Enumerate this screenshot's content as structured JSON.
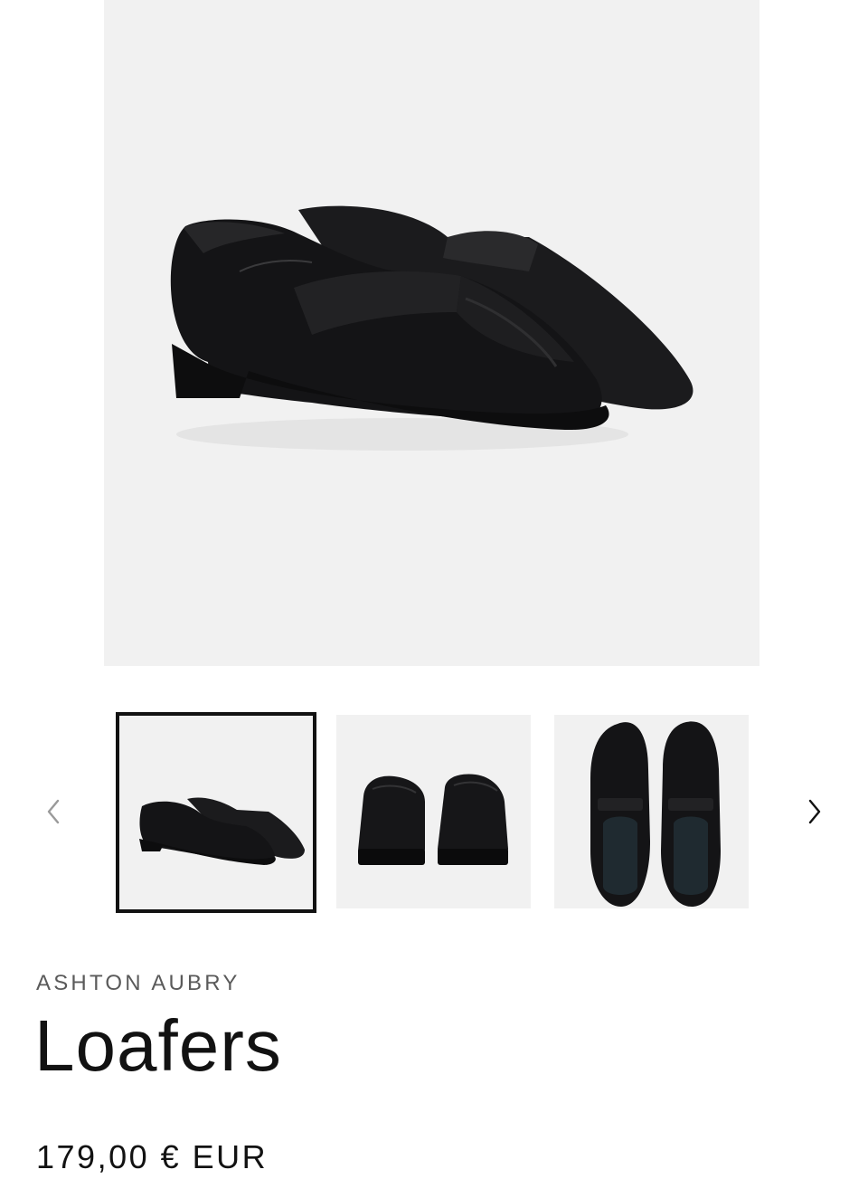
{
  "product": {
    "vendor": "ASHTON AUBRY",
    "title": "Loafers",
    "price": "179,00 € EUR"
  },
  "gallery": {
    "main_image": "black-leather-penny-loafers-pair-image",
    "thumbnails": [
      {
        "image": "loafers-side-view-image",
        "selected": true
      },
      {
        "image": "loafers-back-view-image",
        "selected": false
      },
      {
        "image": "loafers-top-view-image",
        "selected": false
      }
    ],
    "prev_icon": "chevron-left-icon",
    "next_icon": "chevron-right-icon"
  },
  "colors": {
    "image_background": "#f1f1f1",
    "text": "#121212",
    "vendor_text": "#5a5a5a",
    "selected_border": "#121212"
  }
}
